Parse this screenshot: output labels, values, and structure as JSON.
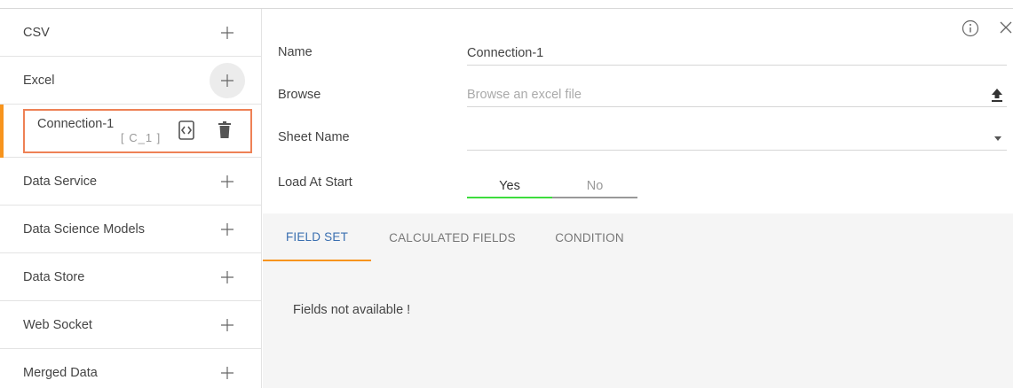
{
  "sidebar": {
    "items": [
      {
        "label": "CSV"
      },
      {
        "label": "Excel"
      },
      {
        "label": "Data Service"
      },
      {
        "label": "Data Science Models"
      },
      {
        "label": "Data Store"
      },
      {
        "label": "Web Socket"
      },
      {
        "label": "Merged Data"
      }
    ],
    "connection": {
      "name": "Connection-1",
      "code": "[ C_1 ]"
    }
  },
  "form": {
    "name_label": "Name",
    "name_value": "Connection-1",
    "browse_label": "Browse",
    "browse_placeholder": "Browse an excel file",
    "sheet_label": "Sheet Name",
    "sheet_value": "",
    "load_label": "Load At Start",
    "load_yes": "Yes",
    "load_no": "No",
    "load_selected": "Yes"
  },
  "tabs": [
    {
      "label": "FIELD SET",
      "active": true
    },
    {
      "label": "CALCULATED FIELDS",
      "active": false
    },
    {
      "label": "CONDITION",
      "active": false
    }
  ],
  "empty_message": "Fields not available !",
  "colors": {
    "accent_orange": "#f7941d",
    "selection_border": "#ee8155",
    "active_tab_text": "#3a6fb0",
    "toggle_on": "#3ddc3d"
  },
  "icons": [
    "plus-icon",
    "code-icon",
    "trash-icon",
    "info-icon",
    "close-icon",
    "upload-icon",
    "caret-down-icon"
  ]
}
